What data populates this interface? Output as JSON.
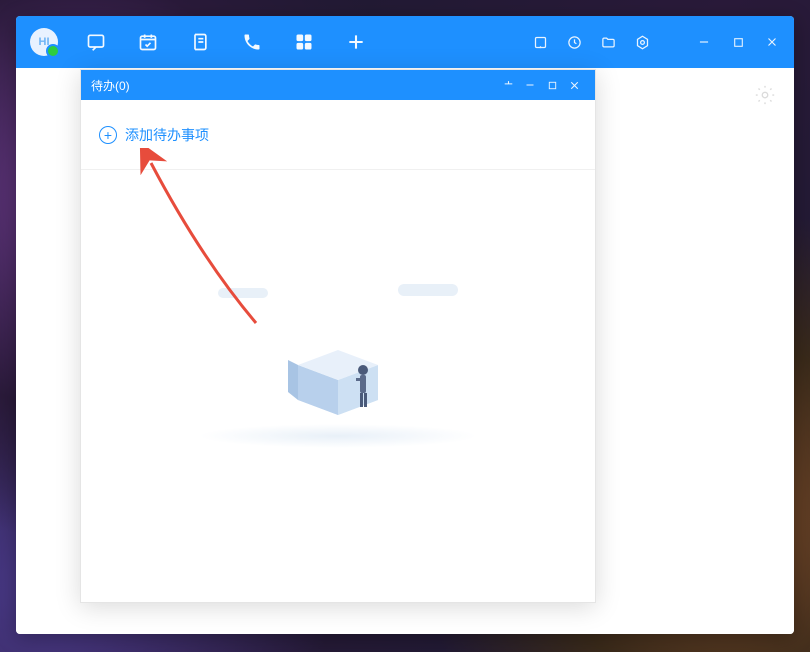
{
  "avatar_text": "HI",
  "todo": {
    "title": "待办(0)",
    "add_label": "添加待办事项"
  },
  "icons": {
    "chat": "chat-icon",
    "calendar": "calendar-check-icon",
    "notes": "notes-icon",
    "phone": "phone-icon",
    "apps": "apps-grid-icon",
    "plus": "plus-icon",
    "mini_app": "mini-app-icon",
    "history": "history-icon",
    "folder": "folder-icon",
    "hexagon": "hexagon-settings-icon",
    "window_min": "minimize-icon",
    "window_max": "maximize-icon",
    "window_close": "close-icon",
    "pin": "pin-icon",
    "settings": "gear-icon"
  }
}
